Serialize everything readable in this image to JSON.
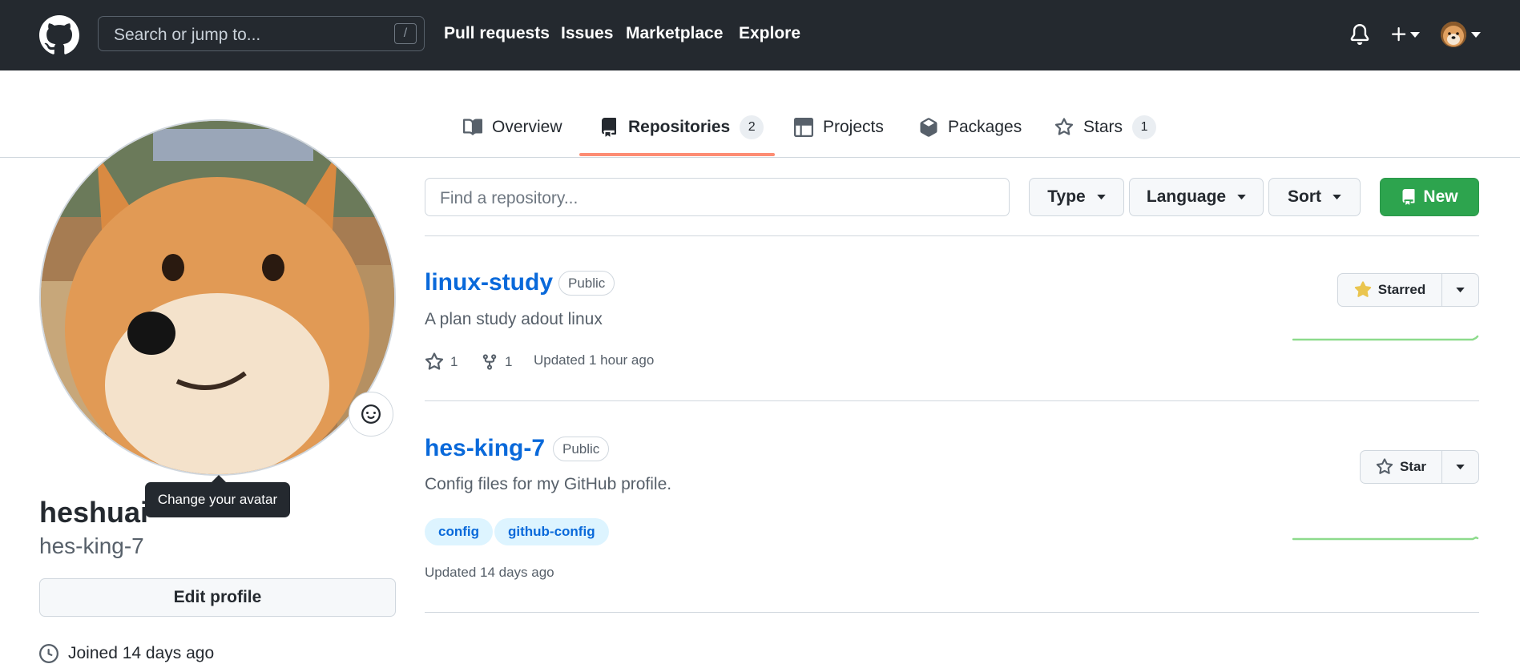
{
  "header": {
    "search_placeholder": "Search or jump to...",
    "search_shortcut": "/",
    "nav": [
      "Pull requests",
      "Issues",
      "Marketplace",
      "Explore"
    ]
  },
  "tabs": [
    {
      "label": "Overview",
      "icon": "book-icon"
    },
    {
      "label": "Repositories",
      "icon": "repo-icon",
      "count": "2",
      "active": true
    },
    {
      "label": "Projects",
      "icon": "table-icon"
    },
    {
      "label": "Packages",
      "icon": "package-icon"
    },
    {
      "label": "Stars",
      "icon": "star-icon",
      "count": "1"
    }
  ],
  "profile": {
    "tooltip": "Change your avatar",
    "fullname": "heshuai",
    "username": "hes-king-7",
    "edit_label": "Edit profile",
    "joined": "Joined 14 days ago"
  },
  "filters": {
    "find_placeholder": "Find a repository...",
    "type_label": "Type",
    "language_label": "Language",
    "sort_label": "Sort",
    "new_label": "New"
  },
  "repos": [
    {
      "name": "linux-study",
      "visibility": "Public",
      "description": "A plan study adout linux",
      "stars": "1",
      "forks": "1",
      "updated": "Updated 1 hour ago",
      "star_button": "Starred",
      "starred": true
    },
    {
      "name": "hes-king-7",
      "visibility": "Public",
      "description": "Config files for my GitHub profile.",
      "topics": [
        "config",
        "github-config"
      ],
      "updated": "Updated 14 days ago",
      "star_button": "Star",
      "starred": false
    }
  ],
  "colors": {
    "header_bg": "#24292f",
    "link": "#0969da",
    "new_button": "#2da44e",
    "tab_underline": "#fd8c73",
    "starred_icon": "#eac54f",
    "sparkline": "#2da44e"
  }
}
